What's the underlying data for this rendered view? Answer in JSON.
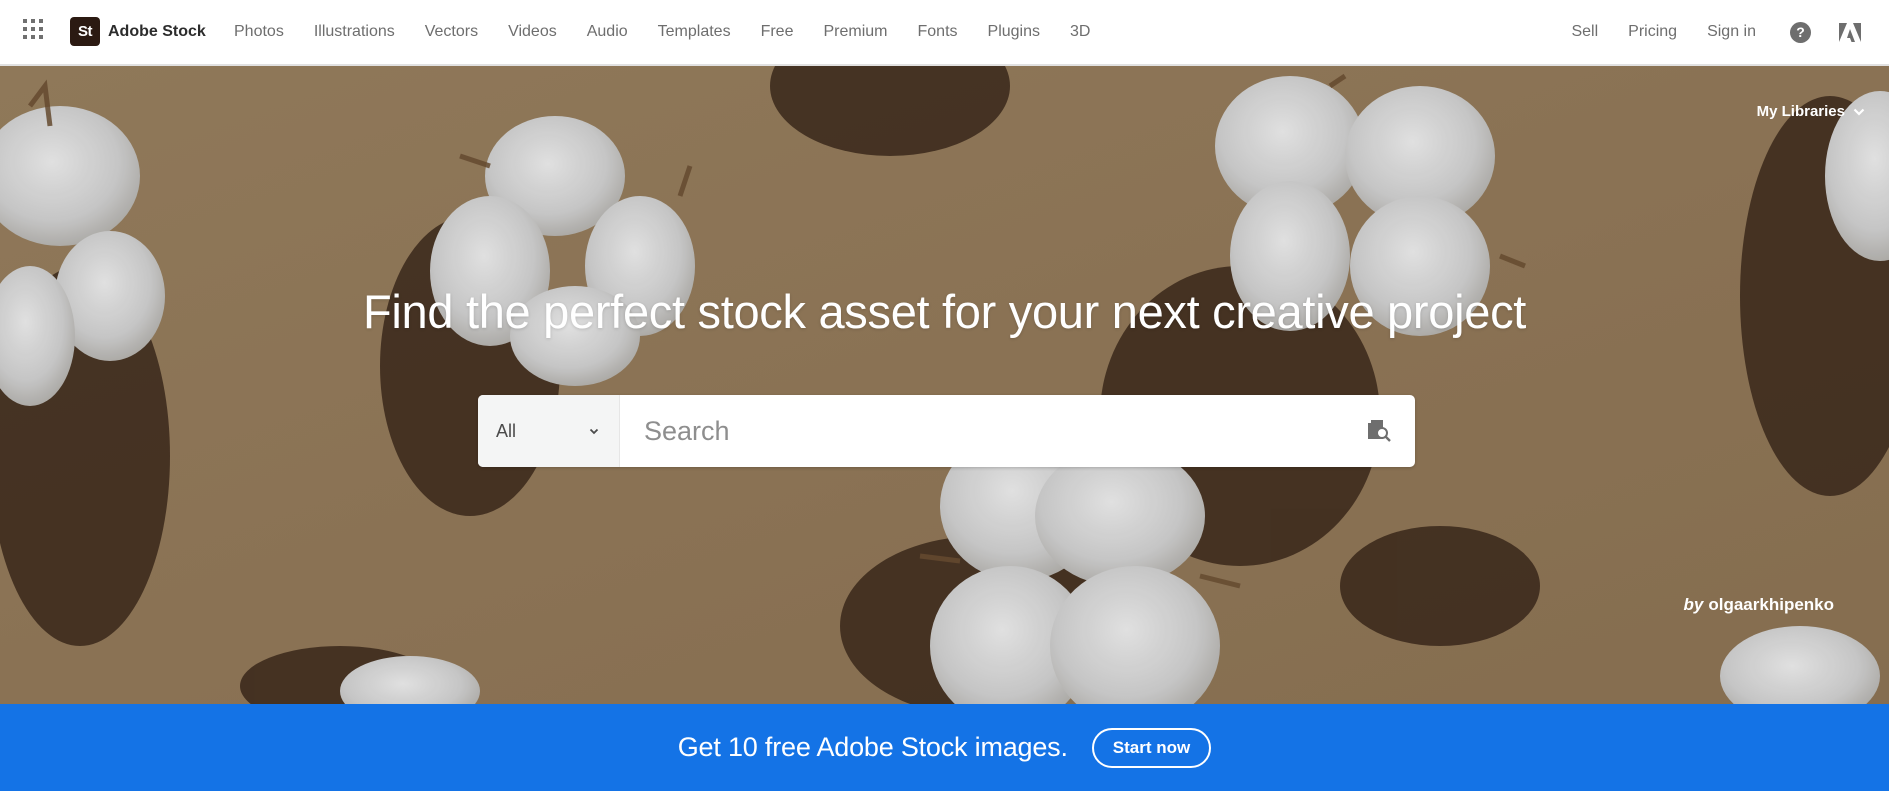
{
  "header": {
    "app_switcher_icon": "grid-icon",
    "logo": {
      "badge": "St",
      "text": "Adobe Stock"
    },
    "nav": [
      {
        "label": "Photos"
      },
      {
        "label": "Illustrations"
      },
      {
        "label": "Vectors"
      },
      {
        "label": "Videos"
      },
      {
        "label": "Audio"
      },
      {
        "label": "Templates"
      },
      {
        "label": "Free"
      },
      {
        "label": "Premium"
      },
      {
        "label": "Fonts"
      },
      {
        "label": "Plugins"
      },
      {
        "label": "3D"
      }
    ],
    "right": {
      "sell": "Sell",
      "pricing": "Pricing",
      "sign_in": "Sign in",
      "help_icon": "?",
      "adobe_icon": "adobe-logo-icon"
    }
  },
  "hero": {
    "my_libraries": "My Libraries",
    "title": "Find the perfect stock asset for your next creative project",
    "search": {
      "type_selected": "All",
      "placeholder": "Search",
      "value": "",
      "visual_search_icon": "visual-search-icon"
    },
    "credit": {
      "by": "by",
      "author": "olgaarkhipenko"
    }
  },
  "banner": {
    "text": "Get 10 free Adobe Stock images.",
    "button": "Start now"
  },
  "colors": {
    "banner_blue": "#1473e6",
    "logo_badge": "#2b1a12",
    "nav_text": "#6e6e6e",
    "hero_background": "#93795a"
  }
}
